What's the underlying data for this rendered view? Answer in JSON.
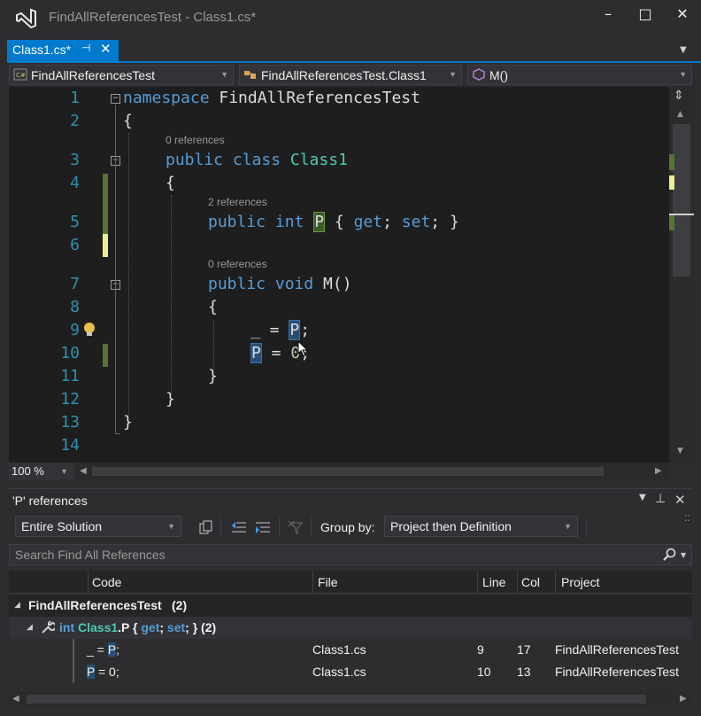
{
  "window": {
    "title": "FindAllReferencesTest - Class1.cs*",
    "minimize_glyph": "–",
    "maximize_glyph": "□",
    "close_glyph": "✕"
  },
  "tab": {
    "label": "Class1.cs*",
    "pin_glyph": "⊣",
    "close_glyph": "✕"
  },
  "navbar": {
    "project": "FindAllReferencesTest",
    "type": "FindAllReferencesTest.Class1",
    "member": "M()"
  },
  "editor": {
    "lines": [
      {
        "n": "1"
      },
      {
        "n": "2"
      },
      {
        "n": "3"
      },
      {
        "n": "4"
      },
      {
        "n": "5"
      },
      {
        "n": "6"
      },
      {
        "n": "7"
      },
      {
        "n": "8"
      },
      {
        "n": "9"
      },
      {
        "n": "10"
      },
      {
        "n": "11"
      },
      {
        "n": "12"
      },
      {
        "n": "13"
      },
      {
        "n": "14"
      }
    ],
    "code": {
      "l1_kw": "namespace",
      "l1_name": " FindAllReferencesTest",
      "l2": "{",
      "l3_kw": "public class",
      "l3_type": " Class1",
      "l4": "{",
      "l5_kw1": "public int",
      "l5_p": "P",
      "l5_rest1": " { ",
      "l5_get": "get",
      "l5_rest2": "; ",
      "l5_set": "set",
      "l5_rest3": "; }",
      "l7_kw": "public void",
      "l7_rest": " M()",
      "l8": "{",
      "l9_disc": "_",
      "l9_eq": " = ",
      "l9_p": "P",
      "l9_semi": ";",
      "l10_p": "P",
      "l10_eq": " = ",
      "l10_num": "0",
      "l10_semi": ";",
      "l11": "}",
      "l12": "}",
      "l13": "}"
    },
    "lens": {
      "class": "0 references",
      "property": "2 references",
      "method": "0 references"
    },
    "zoom": "100 %"
  },
  "find_refs": {
    "title": "'P' references",
    "scope": "Entire Solution",
    "group_by_label": "Group by:",
    "group_by_value": "Project then Definition",
    "search_placeholder": "Search Find All References",
    "columns": [
      "Code",
      "File",
      "Line",
      "Col",
      "Project"
    ],
    "group_project": "FindAllReferencesTest",
    "group_project_count": "(2)",
    "definition": {
      "kw1": "int",
      "type": "Class1",
      "member": ".P { ",
      "get": "get",
      "mid": "; ",
      "set": "set",
      "end": "; }",
      "count": "(2)"
    },
    "rows": [
      {
        "code_pre": "_ = ",
        "code_hl": "P",
        "code_post": ";",
        "file": "Class1.cs",
        "line": "9",
        "col": "17",
        "project": "FindAllReferencesTest"
      },
      {
        "code_pre": "",
        "code_hl": "P",
        "code_post": " = 0;",
        "file": "Class1.cs",
        "line": "10",
        "col": "13",
        "project": "FindAllReferencesTest"
      }
    ]
  }
}
